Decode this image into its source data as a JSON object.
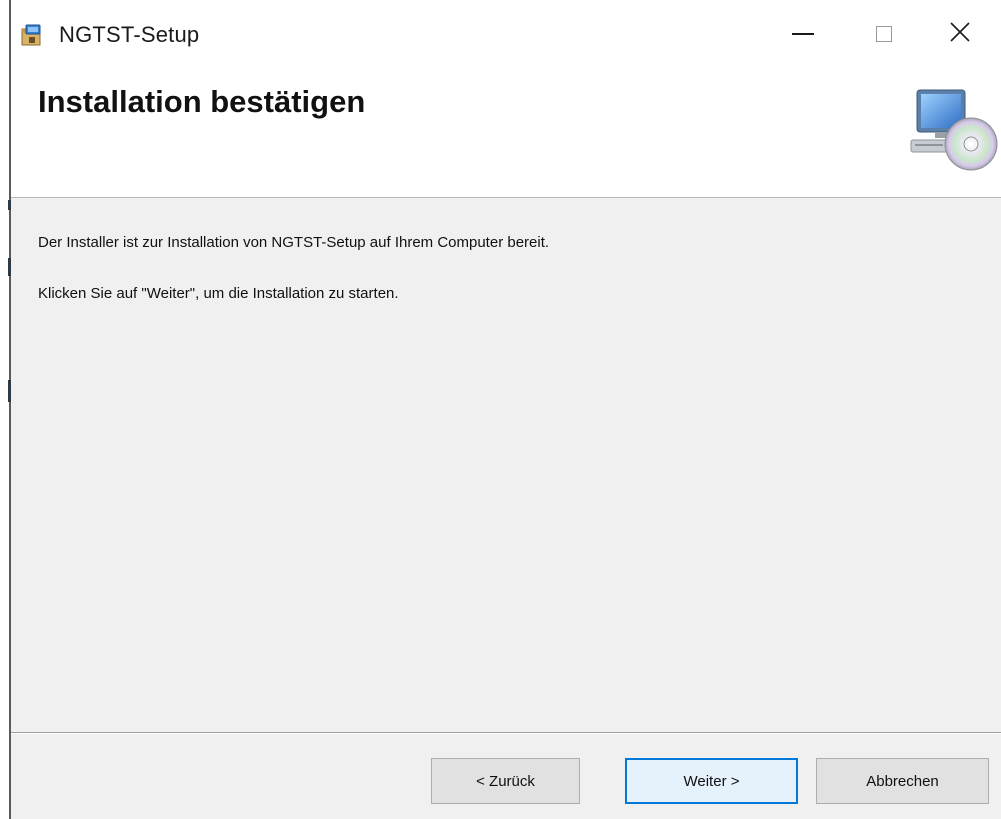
{
  "window": {
    "title": "NGTST-Setup",
    "icon": "installer-package-icon",
    "controls": {
      "minimize": "minimize-icon",
      "maximize": "maximize-icon",
      "close": "close-icon"
    }
  },
  "header": {
    "title": "Installation bestätigen",
    "image": "computer-cd-icon"
  },
  "content": {
    "message1": "Der Installer ist zur Installation von NGTST-Setup auf Ihrem Computer bereit.",
    "message2": "Klicken Sie auf \"Weiter\", um die Installation zu starten."
  },
  "footer": {
    "back_label": "< Zurück",
    "next_label": "Weiter >",
    "cancel_label": "Abbrechen"
  },
  "colors": {
    "content_bg": "#f0f0f0",
    "default_button_border": "#0078d7"
  }
}
